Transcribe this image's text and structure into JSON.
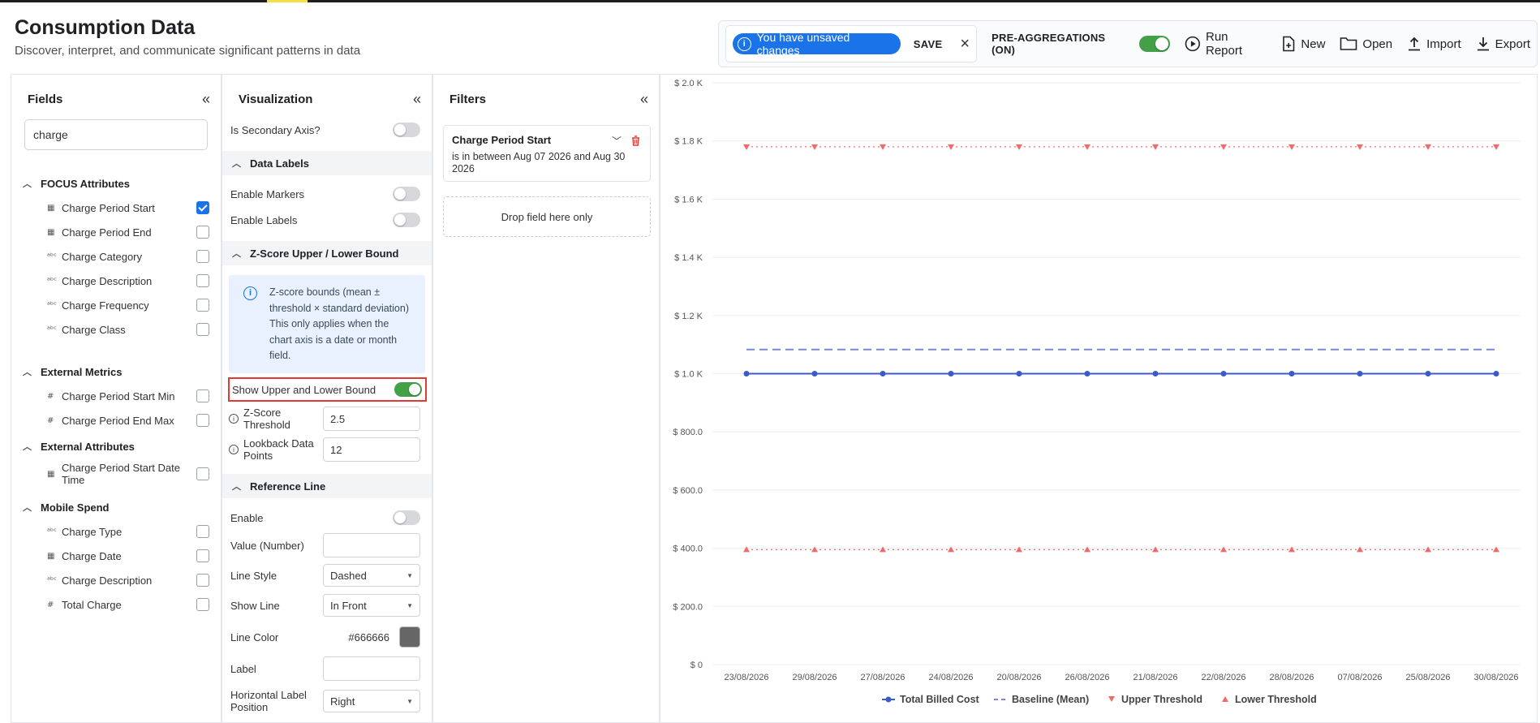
{
  "header": {
    "title": "Consumption Data",
    "subtitle": "Discover, interpret, and communicate significant patterns in data"
  },
  "toolbar": {
    "unsaved_text": "You have unsaved changes",
    "save_label": "SAVE",
    "preagg_label": "PRE-AGGREGATIONS (ON)",
    "run_report": "Run Report",
    "new": "New",
    "open": "Open",
    "import": "Import",
    "export": "Export"
  },
  "fields": {
    "title": "Fields",
    "search_value": "charge",
    "groups": [
      {
        "title": "FOCUS Attributes",
        "items": [
          {
            "type": "calendar-icon",
            "label": "Charge Period Start",
            "checked": true
          },
          {
            "type": "calendar-icon",
            "label": "Charge Period End",
            "checked": false
          },
          {
            "type": "text-type-icon",
            "label": "Charge Category",
            "checked": false
          },
          {
            "type": "text-type-icon",
            "label": "Charge Description",
            "checked": false
          },
          {
            "type": "text-type-icon",
            "label": "Charge Frequency",
            "checked": false
          },
          {
            "type": "text-type-icon",
            "label": "Charge Class",
            "checked": false
          }
        ]
      },
      {
        "title": "External Metrics",
        "items": [
          {
            "type": "number-type-icon",
            "label": "Charge Period Start Min",
            "checked": false
          },
          {
            "type": "number-type-icon",
            "label": "Charge Period End Max",
            "checked": false
          }
        ]
      },
      {
        "title": "External Attributes",
        "items": [
          {
            "type": "calendar-icon",
            "label": "Charge Period Start Date Time",
            "checked": false
          }
        ]
      },
      {
        "title": "Mobile Spend",
        "items": [
          {
            "type": "text-type-icon",
            "label": "Charge Type",
            "checked": false
          },
          {
            "type": "calendar-icon",
            "label": "Charge Date",
            "checked": false
          },
          {
            "type": "text-type-icon",
            "label": "Charge Description",
            "checked": false
          },
          {
            "type": "number-type-icon",
            "label": "Total Charge",
            "checked": false
          }
        ]
      }
    ]
  },
  "visualization": {
    "title": "Visualization",
    "secondary_axis_label": "Is Secondary Axis?",
    "data_labels_section": "Data Labels",
    "enable_markers_label": "Enable Markers",
    "enable_labels_label": "Enable Labels",
    "zscore_section": "Z-Score Upper / Lower Bound",
    "zscore_info": "Z-score bounds (mean ± threshold × standard deviation) This only applies when the chart axis is a date or month field.",
    "show_bounds_label": "Show Upper and Lower Bound",
    "zscore_threshold_label": "Z-Score Threshold",
    "zscore_threshold_value": "2.5",
    "lookback_label": "Lookback Data Points",
    "lookback_value": "12",
    "reference_section": "Reference Line",
    "enable_label": "Enable",
    "value_number_label": "Value (Number)",
    "value_number_value": "",
    "line_style_label": "Line Style",
    "line_style_value": "Dashed",
    "show_line_label": "Show Line",
    "show_line_value": "In Front",
    "line_color_label": "Line Color",
    "line_color_value": "#666666",
    "label_label": "Label",
    "label_value": "",
    "hlabel_position_label": "Horizontal Label Position",
    "hlabel_position_value": "Right"
  },
  "filters": {
    "title": "Filters",
    "card_title": "Charge Period Start",
    "card_desc": "is in between Aug 07 2026 and Aug 30 2026",
    "drop_zone": "Drop field here only"
  },
  "colors": {
    "series_blue": "#3b5bcc",
    "baseline": "#7b86d9",
    "threshold_red": "#ef6b6b",
    "toggle_on": "#43a047",
    "accent": "#1a73e8"
  },
  "chart_data": {
    "type": "line",
    "categories": [
      "23/08/2026",
      "29/08/2026",
      "27/08/2026",
      "24/08/2026",
      "20/08/2026",
      "26/08/2026",
      "21/08/2026",
      "22/08/2026",
      "28/08/2026",
      "07/08/2026",
      "25/08/2026",
      "30/08/2026"
    ],
    "y_ticks": [
      "$ 0",
      "$ 200.0",
      "$ 400.0",
      "$ 600.0",
      "$ 800.0",
      "$ 1.0 K",
      "$ 1.2 K",
      "$ 1.4 K",
      "$ 1.6 K",
      "$ 1.8 K",
      "$ 2.0 K"
    ],
    "ylim": [
      0,
      2000
    ],
    "series": [
      {
        "name": "Total Billed Cost",
        "values": [
          1000,
          1000,
          1000,
          1000,
          1000,
          1000,
          1000,
          1000,
          1000,
          1000,
          1000,
          1000
        ]
      },
      {
        "name": "Baseline (Mean)",
        "values": [
          1083,
          1083,
          1083,
          1083,
          1083,
          1083,
          1083,
          1083,
          1083,
          1083,
          1083,
          1083
        ]
      },
      {
        "name": "Upper Threshold",
        "values": [
          1780,
          1780,
          1780,
          1780,
          1780,
          1780,
          1780,
          1780,
          1780,
          1780,
          1780,
          1780
        ]
      },
      {
        "name": "Lower Threshold",
        "values": [
          395,
          395,
          395,
          395,
          395,
          395,
          395,
          395,
          395,
          395,
          395,
          395
        ]
      }
    ],
    "legend_position": "bottom"
  }
}
